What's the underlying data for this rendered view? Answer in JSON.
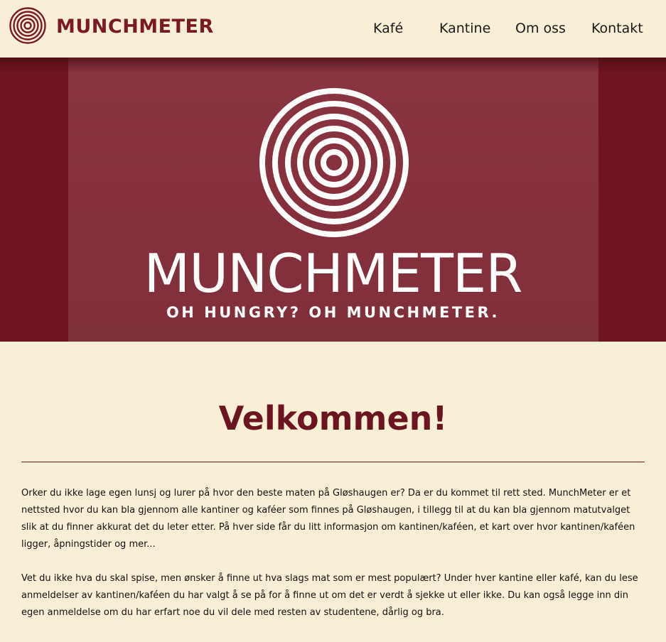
{
  "colors": {
    "background": "#f9efd6",
    "brand": "#7a1a24",
    "hero_background": "#70141f",
    "hero_panel": "#85303c",
    "text": "#1a1a1a"
  },
  "nav": {
    "logo_icon": "munchmeter-rings-logo",
    "brand": "MUNCHMETER",
    "links": [
      {
        "label": "Kafé"
      },
      {
        "label": "Kantine"
      },
      {
        "label": "Om oss"
      },
      {
        "label": "Kontakt"
      }
    ]
  },
  "hero": {
    "logo_icon": "munchmeter-rings-logo",
    "brand": "MUNCHMETER",
    "tagline": "OH HUNGRY? OH MUNCHMETER."
  },
  "main": {
    "heading": "Velkommen!",
    "paragraphs": [
      "Orker du ikke lage egen lunsj og lurer på hvor den beste maten på Gløshaugen er? Da er du kommet til rett sted. MunchMeter er et nettsted hvor du kan bla gjennom alle kantiner og kaféer som finnes på Gløshaugen, i tillegg til at du kan bla gjennom matutvalget slik at du finner akkurat det du leter etter. På hver side får du litt informasjon om kantinen/kaféen, et kart over hvor kantinen/kaféen ligger, åpningstider og mer...",
      "Vet du ikke hva du skal spise, men ønsker å finne ut hva slags mat som er mest populært? Under hver kantine eller kafé, kan du lese anmeldelser av kantinen/kaféen du har valgt å se på for å finne ut om det er verdt å sjekke ut eller ikke. Du kan også legge inn din egen anmeldelse om du har erfart noe du vil dele med resten av studentene, dårlig og bra."
    ]
  }
}
